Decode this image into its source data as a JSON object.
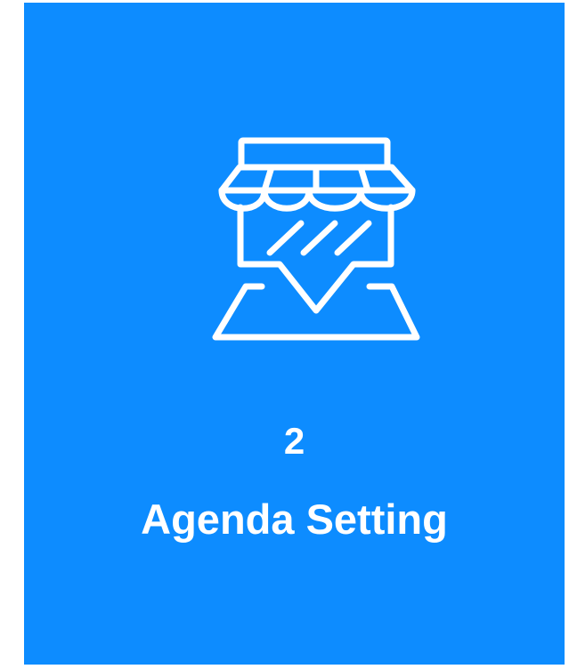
{
  "card": {
    "background_color": "#0d8cff",
    "icon_name": "storefront-icon",
    "step_number": "2",
    "title": "Agenda Setting"
  },
  "colors": {
    "page_background": "#ffffff",
    "icon_stroke": "#ffffff",
    "text": "#ffffff"
  }
}
